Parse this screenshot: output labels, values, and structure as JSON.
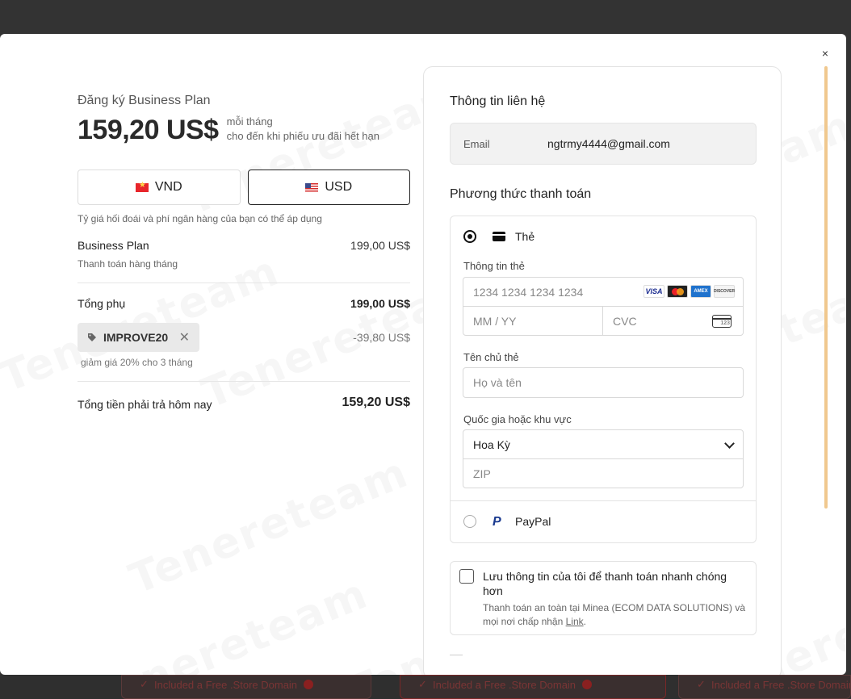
{
  "background": {
    "cards": [
      {
        "label": "Included a Free .Store Domain"
      },
      {
        "label": "Included a Free .Store Domain"
      },
      {
        "label": "Included a Free .Store Domain"
      }
    ]
  },
  "watermark_text": "Tenereteam",
  "close_label": "×",
  "summary": {
    "plan_title": "Đăng ký Business Plan",
    "price": "159,20 US$",
    "price_note_line1": "mỗi tháng",
    "price_note_line2": "cho đến khi phiếu ưu đãi hết hạn",
    "currencies": [
      {
        "code": "VND",
        "active": false
      },
      {
        "code": "USD",
        "active": true
      }
    ],
    "fx_note": "Tỷ giá hối đoái và phí ngân hàng của bạn có thể áp dụng",
    "line_item": {
      "name": "Business Plan",
      "sub": "Thanh toán hàng tháng",
      "value": "199,00 US$"
    },
    "subtotal_label": "Tổng phụ",
    "subtotal_value": "199,00 US$",
    "promo_code": "IMPROVE20",
    "promo_remove": "✕",
    "promo_value": "-39,80 US$",
    "promo_desc": "giảm giá 20% cho 3 tháng",
    "total_label": "Tổng tiền phải trả hôm nay",
    "total_value": "159,20 US$"
  },
  "checkout": {
    "contact_title": "Thông tin liên hệ",
    "email_label": "Email",
    "email_value": "ngtrmy4444@gmail.com",
    "payment_title": "Phương thức thanh toán",
    "card_option_label": "Thẻ",
    "card_info_label": "Thông tin thẻ",
    "card_number_placeholder": "1234 1234 1234 1234",
    "expiry_placeholder": "MM / YY",
    "cvc_placeholder": "CVC",
    "cvc_icon_text": "123",
    "brands": [
      "VISA",
      "",
      "AMEX",
      "DISCOVER"
    ],
    "cardholder_label": "Tên chủ thẻ",
    "cardholder_placeholder": "Họ và tên",
    "country_label": "Quốc gia hoặc khu vực",
    "country_value": "Hoa Kỳ",
    "zip_placeholder": "ZIP",
    "paypal_label": "PayPal",
    "paypal_icon": "P",
    "save_title": "Lưu thông tin của tôi để thanh toán nhanh chóng hơn",
    "save_desc_prefix": "Thanh toán an toàn tại Minea (ECOM DATA SOLUTIONS) và mọi nơi chấp nhận ",
    "save_desc_link": "Link",
    "save_desc_suffix": "."
  },
  "colors": {
    "accent_scrollbar": "#f0c88e",
    "background": "#333333",
    "chip_bg": "#e9e9e9"
  }
}
